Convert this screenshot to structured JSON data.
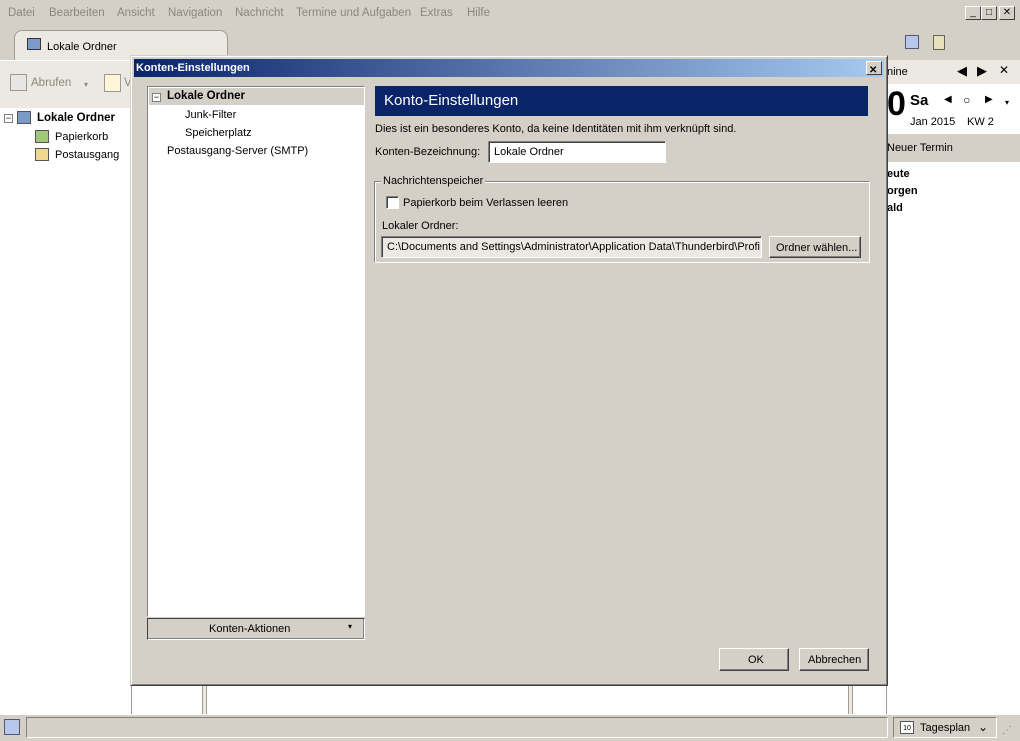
{
  "menubar": {
    "items": [
      "Datei",
      "Bearbeiten",
      "Ansicht",
      "Navigation",
      "Nachricht",
      "Termine und Aufgaben",
      "Extras",
      "Hilfe"
    ]
  },
  "tabs": [
    {
      "label": "Lokale Ordner"
    }
  ],
  "toolbar": {
    "get_mail_label": "Abrufen",
    "write_label_partial": "V"
  },
  "folders": {
    "root": "Lokale Ordner",
    "items": [
      {
        "label": "Papierkorb"
      },
      {
        "label": "Postausgang"
      }
    ]
  },
  "today_pane": {
    "header_partial": "nine",
    "day_number_partial": "0",
    "weekday": "Sa",
    "month_year": "Jan 2015",
    "week": "KW 2",
    "new_event_label": "Neuer Termin",
    "sections": [
      "eute",
      "orgen",
      "ald"
    ]
  },
  "dialog": {
    "title": "Konten-Einstellungen",
    "close_glyph": "✕",
    "tree": {
      "account": "Lokale Ordner",
      "children": [
        "Junk-Filter",
        "Speicherplatz"
      ],
      "smtp": "Postausgang-Server (SMTP)"
    },
    "account_actions_label": "Konten-Aktionen",
    "panel_title": "Konto-Einstellungen",
    "description": "Dies ist ein besonderes Konto, da keine Identitäten mit ihm verknüpft sind.",
    "account_name_label": "Konten-Bezeichnung:",
    "account_name_value": "Lokale Ordner",
    "storage_group_label": "Nachrichtenspeicher",
    "empty_trash_label": "Papierkorb beim Verlassen leeren",
    "empty_trash_checked": false,
    "local_folder_label": "Lokaler Ordner:",
    "local_folder_value": "C:\\Documents and Settings\\Administrator\\Application Data\\Thunderbird\\Profi",
    "choose_folder_label": "Ordner wählen...",
    "ok_label": "OK",
    "cancel_label": "Abbrechen"
  },
  "statusbar": {
    "view_label": "Tagesplan",
    "calendar_icon_day": "10"
  },
  "colors": {
    "title_gradient_start": "#0a246a",
    "title_gradient_end": "#a6caf0",
    "panel_header": "#0a246a"
  }
}
